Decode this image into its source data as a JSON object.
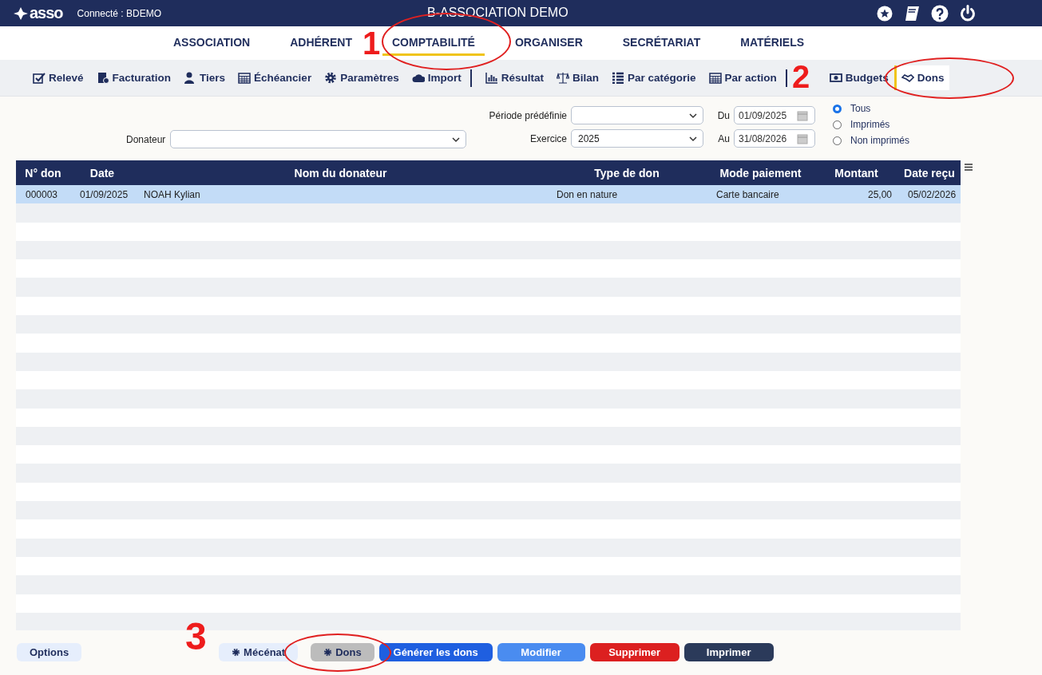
{
  "header": {
    "logo": "asso",
    "user": "Connecté : BDEMO",
    "title": "B-ASSOCIATION DEMO"
  },
  "menu": [
    {
      "label": "ASSOCIATION",
      "selected": false
    },
    {
      "label": "ADHÉRENT",
      "selected": false
    },
    {
      "label": "COMPTABILITÉ",
      "selected": true
    },
    {
      "label": "ORGANISER",
      "selected": false
    },
    {
      "label": "SECRÉTARIAT",
      "selected": false
    },
    {
      "label": "MATÉRIELS",
      "selected": false
    }
  ],
  "toolbar": [
    {
      "label": "Relevé",
      "selected": false
    },
    {
      "label": "Facturation",
      "selected": false
    },
    {
      "label": "Tiers",
      "selected": false
    },
    {
      "label": "Échéancier",
      "selected": false
    },
    {
      "label": "Paramètres",
      "selected": false
    },
    {
      "label": "Import",
      "selected": false
    },
    {
      "label": "Résultat",
      "selected": false
    },
    {
      "label": "Bilan",
      "selected": false
    },
    {
      "label": "Par catégorie",
      "selected": false
    },
    {
      "label": "Par action",
      "selected": false
    },
    {
      "label": "Budgets",
      "selected": false
    },
    {
      "label": "Dons",
      "selected": true
    }
  ],
  "filters": {
    "donateur": {
      "label": "Donateur"
    },
    "periode": {
      "label": "Période prédéfinie"
    },
    "exercice": {
      "label": "Exercice",
      "value": "2025"
    },
    "du": {
      "label": "Du",
      "value": "01/09/2025"
    },
    "au": {
      "label": "Au",
      "value": "31/08/2026"
    },
    "print_state": [
      {
        "label": "Tous",
        "selected": true
      },
      {
        "label": "Imprimés",
        "selected": false
      },
      {
        "label": "Non imprimés",
        "selected": false
      }
    ]
  },
  "table": {
    "columns": [
      "N° don",
      "Date",
      "Nom du donateur",
      "Type de don",
      "Mode paiement",
      "Montant",
      "Date reçu"
    ],
    "rows": [
      {
        "cells": [
          "000003",
          "01/09/2025",
          "NOAH Kylian",
          "Don en nature",
          "Carte bancaire",
          "25,00",
          "05/02/2026"
        ],
        "selected": true
      }
    ]
  },
  "buttons": [
    {
      "label": "Options",
      "kind": "light"
    },
    {
      "label": "Mécénat",
      "kind": "light"
    },
    {
      "label": "Dons",
      "kind": "grey"
    },
    {
      "label": "Générer les dons",
      "kind": "primary"
    },
    {
      "label": "Modifier",
      "kind": "secondary"
    },
    {
      "label": "Supprimer",
      "kind": "danger"
    },
    {
      "label": "Imprimer",
      "kind": "dark"
    }
  ],
  "annotations": [
    {
      "label": "1"
    },
    {
      "label": "2"
    },
    {
      "label": "3"
    }
  ]
}
